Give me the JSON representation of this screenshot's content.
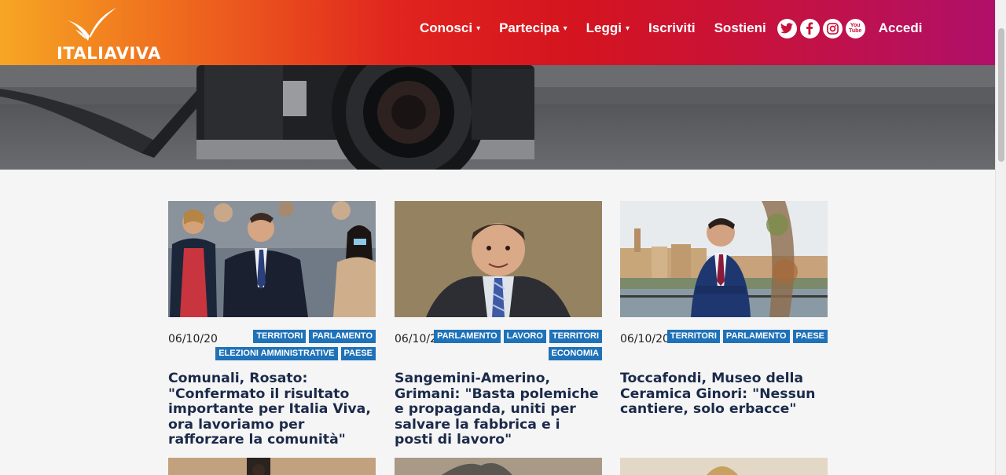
{
  "brand": {
    "name": "ITALIAVIVA"
  },
  "nav": {
    "items": [
      {
        "label": "Conosci",
        "caret": "▾"
      },
      {
        "label": "Partecipa",
        "caret": "▾"
      },
      {
        "label": "Leggi",
        "caret": "▾"
      },
      {
        "label": "Iscriviti",
        "caret": ""
      },
      {
        "label": "Sostieni",
        "caret": ""
      }
    ],
    "socials": [
      "twitter-icon",
      "facebook-icon",
      "instagram-icon",
      "youtube-icon"
    ],
    "youtube_label_top": "You",
    "youtube_label_bottom": "Tube",
    "login": "Accedi"
  },
  "articles": [
    {
      "date": "06/10/20",
      "tags": [
        "TERRITORI",
        "PARLAMENTO",
        "ELEZIONI AMMINISTRATIVE",
        "PAESE"
      ],
      "title": "Comunali, Rosato: \"Confermato il risultato importante per Italia Viva, ora lavoriamo per rafforzare la comunità\""
    },
    {
      "date": "06/10/20",
      "tags": [
        "PARLAMENTO",
        "LAVORO",
        "TERRITORI",
        "ECONOMIA"
      ],
      "title": "Sangemini-Amerino, Grimani: \"Basta polemiche e propaganda, uniti per salvare la fabbrica e i posti di lavoro\""
    },
    {
      "date": "06/10/20",
      "tags": [
        "TERRITORI",
        "PARLAMENTO",
        "PAESE"
      ],
      "title": "Toccafondi, Museo della Ceramica Ginori: \"Nessun cantiere, solo erbacce\""
    }
  ],
  "colors": {
    "tag": "#1f72b8",
    "title": "#1b2a4a",
    "header_start": "#f6a623",
    "header_end": "#b0106a"
  }
}
